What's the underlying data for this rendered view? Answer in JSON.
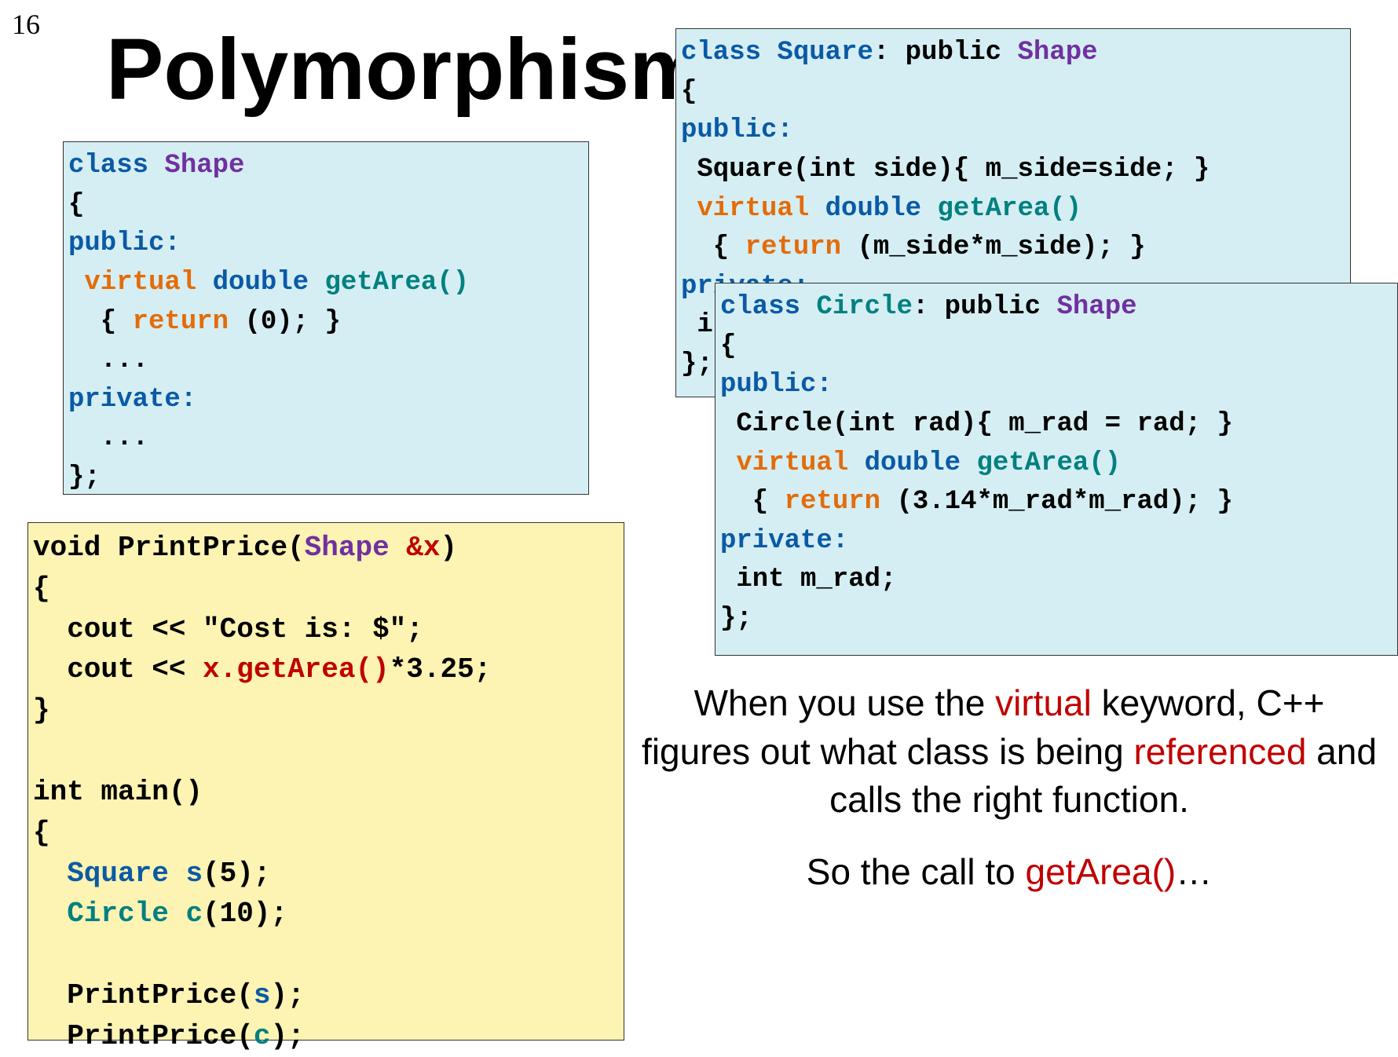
{
  "page_number": "16",
  "title": "Polymorphism",
  "shape_box": {
    "l1a": "class ",
    "l1b": "Shape",
    "l2": "{",
    "l3": "public:",
    "l4a": " virtual",
    "l4b": " double",
    "l4c": " getArea()",
    "l5a": "  { ",
    "l5b": "return ",
    "l5c": "(0); }",
    "l6": "  ...",
    "l7": "private:",
    "l8": "  ...",
    "l9": "};"
  },
  "square_box": {
    "l1a": "class ",
    "l1b": "Square",
    "l1c": ": public ",
    "l1d": "Shape",
    "l2": "{",
    "l3": "public:",
    "l4": " Square(int side){ m_side=side; }",
    "l5a": " virtual",
    "l5b": " double",
    "l5c": " getArea()",
    "l6a": "  { ",
    "l6b": "return ",
    "l6c": "(m_side*m_side); }",
    "l7": "private:",
    "l8": " int m_side;",
    "l9": "};"
  },
  "circle_box": {
    "l1a": "class ",
    "l1b": "Circle",
    "l1c": ": public ",
    "l1d": "Shape",
    "l2": "{",
    "l3": "public:",
    "l4": " Circle(int rad){ m_rad = rad; }",
    "l5a": " virtual",
    "l5b": " double",
    "l5c": " getArea()",
    "l6a": "  { ",
    "l6b": "return ",
    "l6c": "(3.14*m_rad*m_rad); }",
    "l7": "private:",
    "l8": " int m_rad;",
    "l9": "};"
  },
  "main_box": {
    "l1a": "void PrintPrice(",
    "l1b": "Shape ",
    "l1c": "&x",
    "l1d": ")",
    "l2": "{",
    "l3": "  cout << \"Cost is: $\";",
    "l4a": "  cout << ",
    "l4b": "x.getArea()",
    "l4c": "*3.25;",
    "l5": "}",
    "l6": "",
    "l7": "int main()",
    "l8": "{",
    "l9a": "  Square ",
    "l9b": "s",
    "l9c": "(5);",
    "l10a": "  Circle ",
    "l10b": "c",
    "l10c": "(10);",
    "l11": "",
    "l12a": "  PrintPrice(",
    "l12b": "s",
    "l12c": ");",
    "l13a": "  PrintPrice(",
    "l13b": "c",
    "l13c": ");"
  },
  "para1": {
    "t1": "When you use the ",
    "t2": "virtual",
    "t3": " keyword, C++ figures out what class is being ",
    "t4": "referenced",
    "t5": " and calls the right function."
  },
  "para2": {
    "t1": "So the call to ",
    "t2": "getArea()",
    "t3": "…"
  }
}
